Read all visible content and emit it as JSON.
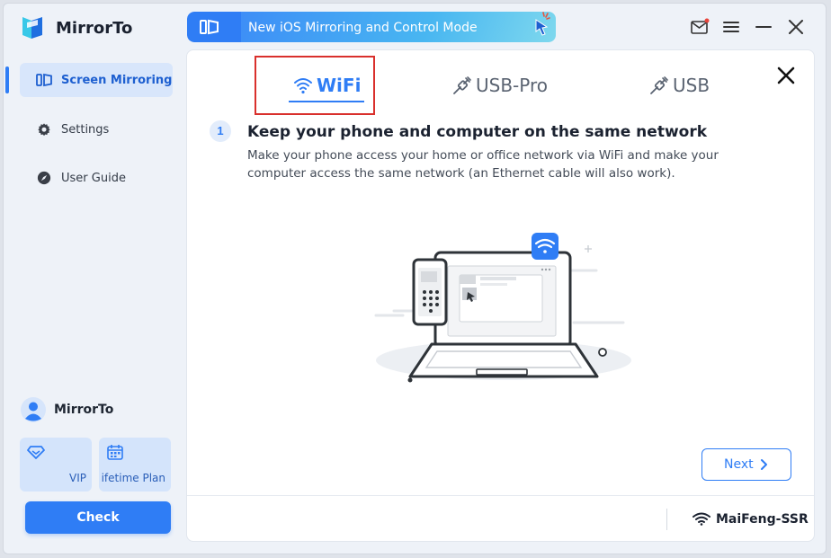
{
  "app": {
    "title": "MirrorTo"
  },
  "banner": {
    "text": "New iOS Mirroring and Control Mode"
  },
  "colors": {
    "accent": "#2f7df5",
    "highlight_border": "#d9302c",
    "sidebar_bg": "#eef2f8"
  },
  "sidebar": {
    "items": [
      {
        "label": "Screen Mirroring",
        "icon": "screen-mirroring-icon",
        "active": true
      },
      {
        "label": "Settings",
        "icon": "gear-icon",
        "active": false
      },
      {
        "label": "User Guide",
        "icon": "compass-icon",
        "active": false
      }
    ],
    "user": {
      "name": "MirrorTo"
    },
    "plans": [
      {
        "label": "VIP",
        "icon": "diamond-icon"
      },
      {
        "label": "ifetime Plan",
        "icon": "calendar-icon"
      }
    ],
    "check_label": "Check"
  },
  "main": {
    "tabs": [
      {
        "label": "WiFi",
        "icon": "wifi-icon",
        "active": true
      },
      {
        "label": "USB-Pro",
        "icon": "usb-plug-icon",
        "active": false
      },
      {
        "label": "USB",
        "icon": "usb-plug-icon",
        "active": false
      }
    ],
    "step": {
      "number": "1",
      "title": "Keep your phone and computer on the same network",
      "description": "Make your phone access your home or office network via WiFi and make your computer access the same network (an Ethernet cable will also work)."
    },
    "next_label": "Next",
    "network_name": "MaiFeng-SSR"
  }
}
